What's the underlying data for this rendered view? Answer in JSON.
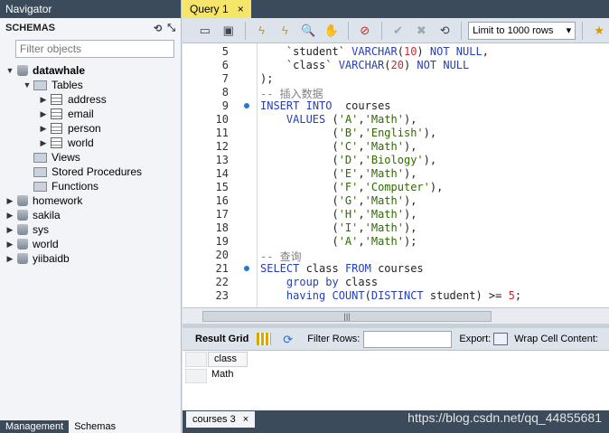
{
  "navigator": {
    "title": "Navigator",
    "schemas_label": "SCHEMAS",
    "filter_placeholder": "Filter objects",
    "tree": [
      {
        "label": "datawhale",
        "bold": true
      },
      {
        "label": "Tables"
      },
      {
        "label": "address"
      },
      {
        "label": "email"
      },
      {
        "label": "person"
      },
      {
        "label": "world"
      },
      {
        "label": "Views"
      },
      {
        "label": "Stored Procedures"
      },
      {
        "label": "Functions"
      },
      {
        "label": "homework"
      },
      {
        "label": "sakila"
      },
      {
        "label": "sys"
      },
      {
        "label": "world"
      },
      {
        "label": "yiibaidb"
      }
    ],
    "bottom_tabs": [
      "Management",
      "Schemas"
    ]
  },
  "query_tab": {
    "label": "Query 1",
    "close": "×"
  },
  "toolbar": {
    "limit_label": "Limit to 1000 rows"
  },
  "editor": {
    "lines": [
      {
        "n": "5",
        "code": "    `student` VARCHAR(10) NOT NULL,"
      },
      {
        "n": "6",
        "code": "    `class` VARCHAR(20) NOT NULL"
      },
      {
        "n": "7",
        "code": ");"
      },
      {
        "n": "8",
        "code": "-- 插入数据"
      },
      {
        "n": "9",
        "code": "INSERT INTO  courses",
        "dot": true
      },
      {
        "n": "10",
        "code": "    VALUES ('A','Math'),"
      },
      {
        "n": "11",
        "code": "           ('B','English'),"
      },
      {
        "n": "12",
        "code": "           ('C','Math'),"
      },
      {
        "n": "13",
        "code": "           ('D','Biology'),"
      },
      {
        "n": "14",
        "code": "           ('E','Math'),"
      },
      {
        "n": "15",
        "code": "           ('F','Computer'),"
      },
      {
        "n": "16",
        "code": "           ('G','Math'),"
      },
      {
        "n": "17",
        "code": "           ('H','Math'),"
      },
      {
        "n": "18",
        "code": "           ('I','Math'),"
      },
      {
        "n": "19",
        "code": "           ('A','Math');"
      },
      {
        "n": "20",
        "code": "-- 查询"
      },
      {
        "n": "21",
        "code": "SELECT class FROM courses",
        "dot": true
      },
      {
        "n": "22",
        "code": "    group by class"
      },
      {
        "n": "23",
        "code": "    having COUNT(DISTINCT student) >= 5;"
      }
    ]
  },
  "result": {
    "grid_label": "Result Grid",
    "filter_label": "Filter Rows:",
    "export_label": "Export:",
    "wrap_label": "Wrap Cell Content:",
    "column": "class",
    "rows": [
      "Math"
    ],
    "tab_label": "courses 3",
    "tab_close": "×"
  },
  "watermark": "https://blog.csdn.net/qq_44855681"
}
